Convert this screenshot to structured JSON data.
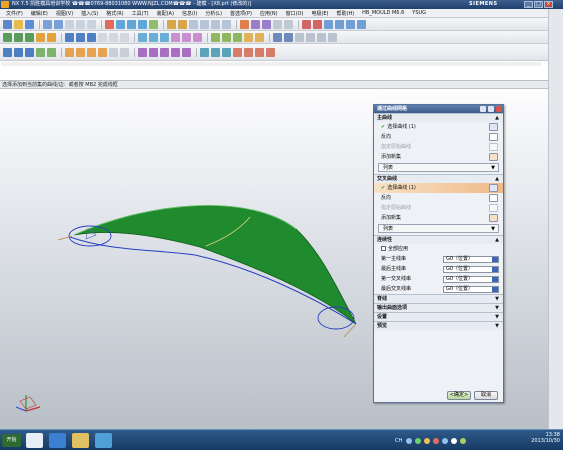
{
  "window": {
    "title": "NX 7.5  凯胜模具培训学校  ☎☎☎0769-88031080  WWW.NJZL.COM☎☎☎ - 建模 - [X8.prt (修改的)]",
    "brand": "SIEMENS"
  },
  "menu": {
    "items": [
      "文件(F)",
      "编辑(E)",
      "视图(V)",
      "插入(S)",
      "格式(R)",
      "工具(T)",
      "装配(A)",
      "信息(I)",
      "分析(L)",
      "首选项(P)",
      "应用(N)",
      "窗口(O)",
      "电极(E)",
      "帮助(H)",
      "HB_MOULD M6.6",
      "YSUG"
    ]
  },
  "status_bar": {
    "text": "选择添加到当前集的曲线/边：或者按 MB2 完成线框"
  },
  "dialog": {
    "title": "通过曲线网格",
    "primary_curves": {
      "header": "主曲线",
      "select_curve": "选择曲线 (1)",
      "reverse": "反向",
      "specify_origin": "指定原始曲线",
      "add_new_set": "添加新集",
      "list": "列表"
    },
    "cross_curves": {
      "header": "交叉曲线",
      "select_curve": "选择曲线 (1)",
      "reverse": "反向",
      "specify_origin": "指定原始曲线",
      "add_new_set": "添加新集",
      "list": "列表"
    },
    "continuity": {
      "header": "连续性",
      "apply_all": "全部应用",
      "rows": [
        {
          "label": "第一主线串",
          "value": "G0（位置）"
        },
        {
          "label": "最后主线串",
          "value": "G0（位置）"
        },
        {
          "label": "第一交叉线串",
          "value": "G0（位置）"
        },
        {
          "label": "最后交叉线串",
          "value": "G0（位置）"
        }
      ]
    },
    "collapsed_sections": [
      "脊线",
      "输出曲面选项",
      "设置",
      "预览"
    ],
    "ok_label": "<确定>",
    "cancel_label": "取消"
  },
  "taskbar": {
    "start_label": "开始",
    "lang": "CH",
    "clock_time": "13:38",
    "clock_date": "2013/10/30"
  },
  "colors": {
    "surface_green": "#1f8a2e",
    "curve_blue": "#2a3fbf",
    "dialog_title": "#4b6b9a",
    "highlight_orange": "#f1b98a"
  }
}
